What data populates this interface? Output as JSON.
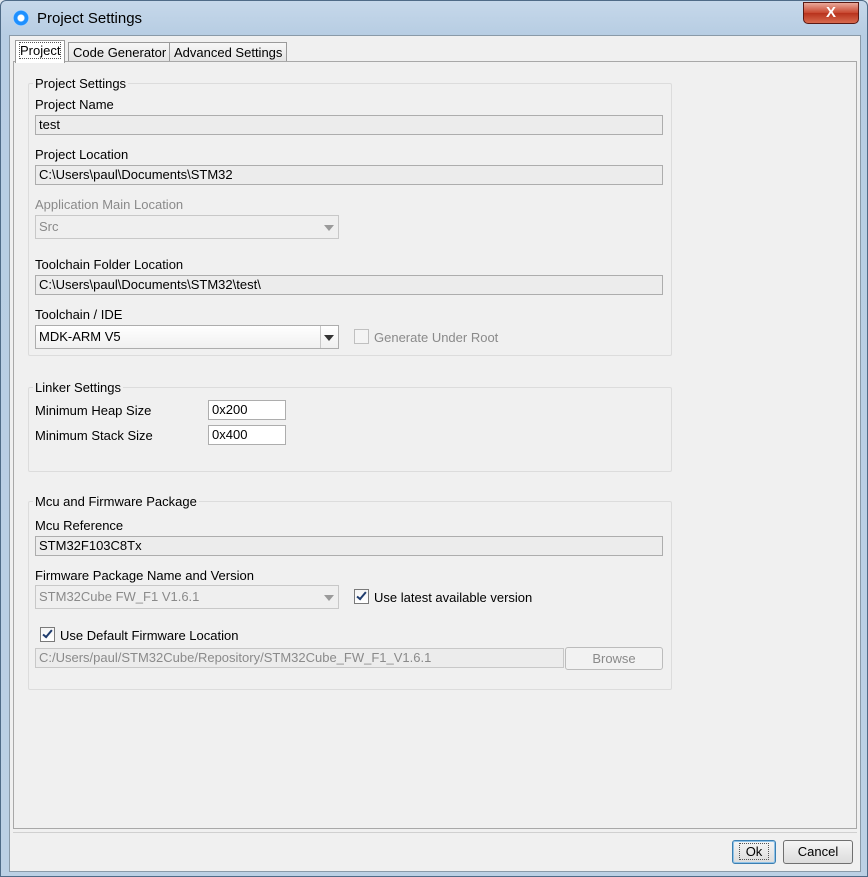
{
  "window": {
    "title": "Project Settings",
    "close_label": "X"
  },
  "tabs": [
    {
      "label": "Project"
    },
    {
      "label": "Code Generator"
    },
    {
      "label": "Advanced Settings"
    }
  ],
  "project_settings": {
    "legend": "Project Settings",
    "project_name_label": "Project Name",
    "project_name_value": "test",
    "project_location_label": "Project Location",
    "project_location_value": "C:\\Users\\paul\\Documents\\STM32",
    "app_main_location_label": "Application Main Location",
    "app_main_location_value": "Src",
    "toolchain_folder_label": "Toolchain Folder Location",
    "toolchain_folder_value": "C:\\Users\\paul\\Documents\\STM32\\test\\",
    "toolchain_ide_label": "Toolchain / IDE",
    "toolchain_ide_value": "MDK-ARM V5",
    "generate_under_root_label": "Generate Under Root",
    "generate_under_root_checked": false
  },
  "linker_settings": {
    "legend": "Linker Settings",
    "min_heap_label": "Minimum Heap Size",
    "min_heap_value": "0x200",
    "min_stack_label": "Minimum Stack Size",
    "min_stack_value": "0x400"
  },
  "mcu_firmware": {
    "legend": "Mcu and Firmware Package",
    "mcu_reference_label": "Mcu Reference",
    "mcu_reference_value": "STM32F103C8Tx",
    "fw_package_label": "Firmware Package Name and Version",
    "fw_package_value": "STM32Cube FW_F1 V1.6.1",
    "use_latest_label": "Use latest available version",
    "use_latest_checked": true,
    "use_default_location_label": "Use Default Firmware Location",
    "use_default_location_checked": true,
    "firmware_location_value": "C:/Users/paul/STM32Cube/Repository/STM32Cube_FW_F1_V1.6.1",
    "browse_label": "Browse"
  },
  "buttons": {
    "ok_label": "Ok",
    "cancel_label": "Cancel"
  }
}
